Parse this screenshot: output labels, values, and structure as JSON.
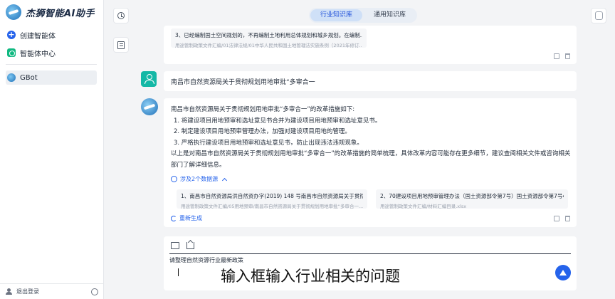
{
  "app": {
    "logo_text": "杰狮智能AI助手"
  },
  "sidebar": {
    "items": [
      {
        "label": "创建智能体",
        "icon": "plus-circle-icon"
      },
      {
        "label": "智能体中心",
        "icon": "agent-center-icon"
      }
    ],
    "active_bot": {
      "label": "GBot",
      "icon": "gbot-logo-icon"
    },
    "logout_label": "退出登录"
  },
  "tabs": [
    {
      "label": "行业知识库",
      "active": true
    },
    {
      "label": "通用知识库",
      "active": false
    }
  ],
  "prev_message": {
    "title": "3、已经编制国土空间规划的，不再编制土地利用总体规划和城乡规划。在编制...",
    "source": "用途管制政策文件汇编/01法律法规/01中华人民共和国土地管理法实施条例（2021年修订..."
  },
  "user_message": "南昌市自然资源局关于贯彻规划用地审批“多审合一",
  "answer": {
    "intro": "南昌市自然资源局关于贯彻规划用地审批“多审合一”的改革措施如下:",
    "points": [
      "1. 将建设项目用地预审和选址意见书合并为建设项目用地预审和选址意见书。",
      "2. 制定建设项目用地预审管理办法，加强对建设项目用地的管理。",
      "3. 严格执行建设项目用地预审和选址意见书，防止出现违法违规现象。"
    ],
    "conclusion": "以上是对南昌市自然资源局关于贯彻规划用地审批“多审合一”的改革措施的简单梳理，具体改革内容可能存在更多细节，建议查阅相关文件或咨询相关部门了解详细信息。",
    "sources_label": "涉及2个数据源",
    "citations": [
      {
        "title": "1、南昌市自然资源局洪自然资办字(2019) 148 号南昌市自然资源局关于贯彻...",
        "source": "用途管制政策文件汇编/05用地预审/南昌市自然资源局关于贯彻规划用地审批“多审合一..."
      },
      {
        "title": "2、70建设项目用地预审管理办法（国土资源部令第7号）国土资源部令第7号4...",
        "source": "用途管制政策文件汇编/材料汇编目录.xlsx"
      }
    ],
    "regenerate_label": "重新生成"
  },
  "input": {
    "value": "请整理自然资源行业最新政策"
  },
  "caption": "输入框输入行业相关的问题",
  "colors": {
    "accent": "#2563eb",
    "user_avatar": "#14b8a6"
  }
}
